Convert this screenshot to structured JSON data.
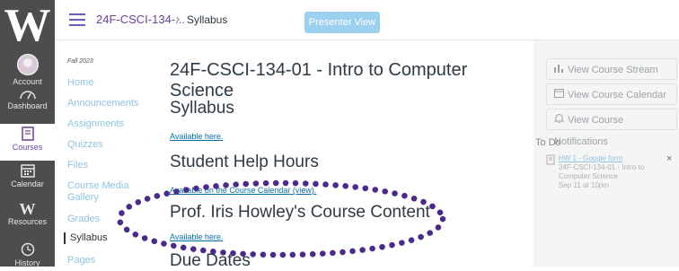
{
  "global_nav": {
    "logo": "W",
    "account": "Account",
    "dashboard": "Dashboard",
    "courses": "Courses",
    "calendar": "Calendar",
    "resources_logo": "W",
    "resources": "Resources",
    "history": "History"
  },
  "header": {
    "course_crumb": "24F-CSCI-134-...",
    "separator": "›",
    "page_crumb": "Syllabus",
    "presenter_button": "Presenter View"
  },
  "course_nav": {
    "term": "Fall 2023",
    "items": [
      "Home",
      "Announcements",
      "Assignments",
      "Quizzes",
      "Files",
      "Course Media Gallery",
      "Grades",
      "Syllabus",
      "Pages"
    ]
  },
  "main": {
    "title": "24F-CSCI-134-01 - Intro to Computer Science",
    "sections": [
      {
        "heading": "Syllabus",
        "link": "Available here."
      },
      {
        "heading": "Student Help Hours",
        "link": "Available on the Course Calendar (view)."
      },
      {
        "heading": "Prof. Iris Howley's Course Content",
        "link": "Available here."
      },
      {
        "heading": "Due Dates"
      }
    ]
  },
  "right_sidebar": {
    "buttons": [
      "View Course Stream",
      "View Course Calendar",
      "View Course Notifications"
    ],
    "todo_heading": "To Do",
    "todo_item": {
      "link": "HW 1 - Google form",
      "course": "24F-CSCI-134-01 - Intro to Computer Science",
      "due": "Sep 11 at 10pm",
      "close": "×"
    }
  },
  "colors": {
    "annotation_dots": "#4b2a8c",
    "link": "#0770a3",
    "nav_bg": "#4d4d4d"
  }
}
